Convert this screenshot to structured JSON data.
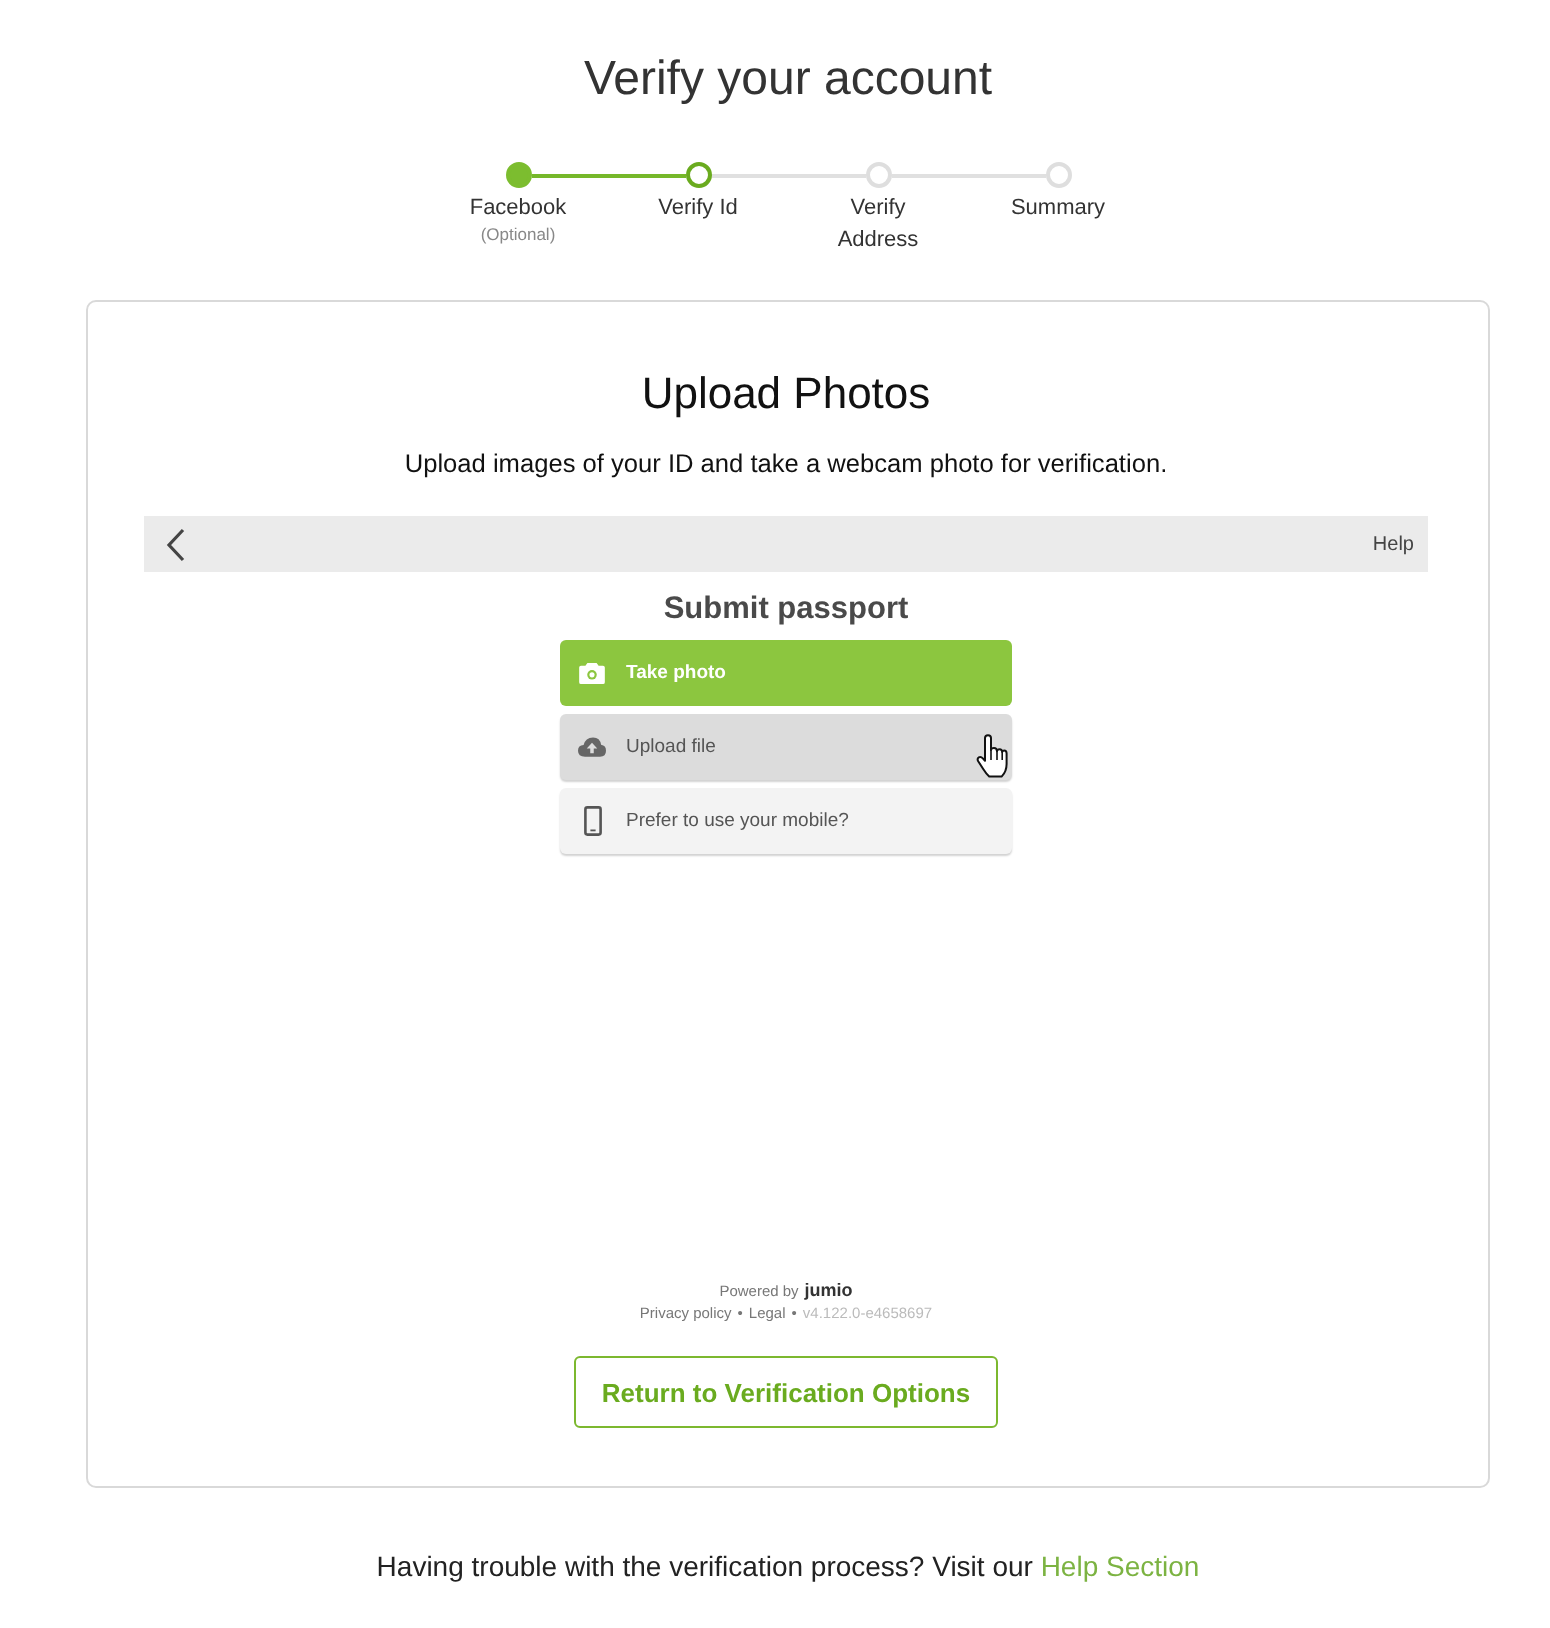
{
  "title": "Verify your account",
  "steps": [
    {
      "label": "Facebook",
      "note": "(Optional)",
      "completed": true,
      "selected": false
    },
    {
      "label": "Verify Id",
      "completed": false,
      "selected": true
    },
    {
      "label": "Verify Address",
      "completed": false,
      "selected": false
    },
    {
      "label": "Summary",
      "completed": false,
      "selected": false
    }
  ],
  "card": {
    "title": "Upload Photos",
    "subtitle": "Upload images of your ID and take a webcam photo for verification.",
    "widget": {
      "help": "Help",
      "heading": "Submit passport",
      "options": [
        {
          "kind": "photo",
          "label": "Take photo",
          "hovered": false
        },
        {
          "kind": "upload",
          "label": "Upload file",
          "hovered": true
        },
        {
          "kind": "mobile",
          "label": "Prefer to use your mobile?",
          "hovered": false
        }
      ],
      "footer": {
        "powered_by": "Powered by",
        "brand": "jumio",
        "items": [
          {
            "kind": "link",
            "text": "Privacy policy"
          },
          {
            "kind": "separator",
            "text": "•"
          },
          {
            "kind": "link",
            "text": "Legal"
          },
          {
            "kind": "separator",
            "text": "•"
          },
          {
            "kind": "version",
            "text": "v4.122.0-e4658697"
          }
        ]
      }
    },
    "button": "Return to Verification Options"
  },
  "help_note": {
    "text": "Having trouble with the verification process? Visit our",
    "link": "Help Section"
  }
}
